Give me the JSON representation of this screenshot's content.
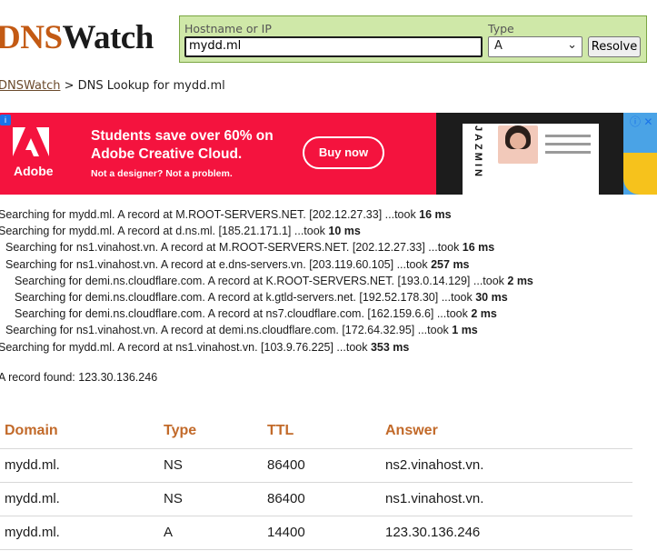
{
  "logo": {
    "part1": "DNS",
    "part2": "Watch"
  },
  "form": {
    "hostname_label": "Hostname or IP",
    "hostname_value": "mydd.ml",
    "type_label": "Type",
    "type_value": "A",
    "resolve_label": "Resolve"
  },
  "breadcrumb": {
    "home": "DNSWatch",
    "separator": ">",
    "current": "DNS Lookup for mydd.ml"
  },
  "ad": {
    "brand": "Adobe",
    "headline": "Students save over 60% on Adobe Creative Cloud.",
    "subline": "Not a designer? Not a problem.",
    "cta": "Buy now",
    "preview_text": "JAZMIN",
    "controls": "ⓘ ✕",
    "colors": {
      "primary": "#f4133e",
      "dark": "#1c1c1c"
    }
  },
  "log": [
    {
      "indent": 0,
      "text": "Searching for mydd.ml. A record at M.ROOT-SERVERS.NET. [202.12.27.33] ...took ",
      "ms": "16 ms"
    },
    {
      "indent": 0,
      "text": "Searching for mydd.ml. A record at d.ns.ml. [185.21.171.1] ...took ",
      "ms": "10 ms"
    },
    {
      "indent": 1,
      "text": "Searching for ns1.vinahost.vn. A record at M.ROOT-SERVERS.NET. [202.12.27.33] ...took ",
      "ms": "16 ms"
    },
    {
      "indent": 1,
      "text": "Searching for ns1.vinahost.vn. A record at e.dns-servers.vn. [203.119.60.105] ...took ",
      "ms": "257 ms"
    },
    {
      "indent": 2,
      "text": "Searching for demi.ns.cloudflare.com. A record at K.ROOT-SERVERS.NET. [193.0.14.129] ...took ",
      "ms": "2 ms"
    },
    {
      "indent": 2,
      "text": "Searching for demi.ns.cloudflare.com. A record at k.gtld-servers.net. [192.52.178.30] ...took ",
      "ms": "30 ms"
    },
    {
      "indent": 2,
      "text": "Searching for demi.ns.cloudflare.com. A record at ns7.cloudflare.com. [162.159.6.6] ...took ",
      "ms": "2 ms"
    },
    {
      "indent": 1,
      "text": "Searching for ns1.vinahost.vn. A record at demi.ns.cloudflare.com. [172.64.32.95] ...took ",
      "ms": "1 ms"
    },
    {
      "indent": 0,
      "text": "Searching for mydd.ml. A record at ns1.vinahost.vn. [103.9.76.225] ...took ",
      "ms": "353 ms"
    }
  ],
  "result": {
    "summary": "A record found: 123.30.136.246"
  },
  "table": {
    "headers": [
      "Domain",
      "Type",
      "TTL",
      "Answer"
    ],
    "rows": [
      [
        "mydd.ml.",
        "NS",
        "86400",
        "ns2.vinahost.vn."
      ],
      [
        "mydd.ml.",
        "NS",
        "86400",
        "ns1.vinahost.vn."
      ],
      [
        "mydd.ml.",
        "A",
        "14400",
        "123.30.136.246"
      ]
    ]
  }
}
